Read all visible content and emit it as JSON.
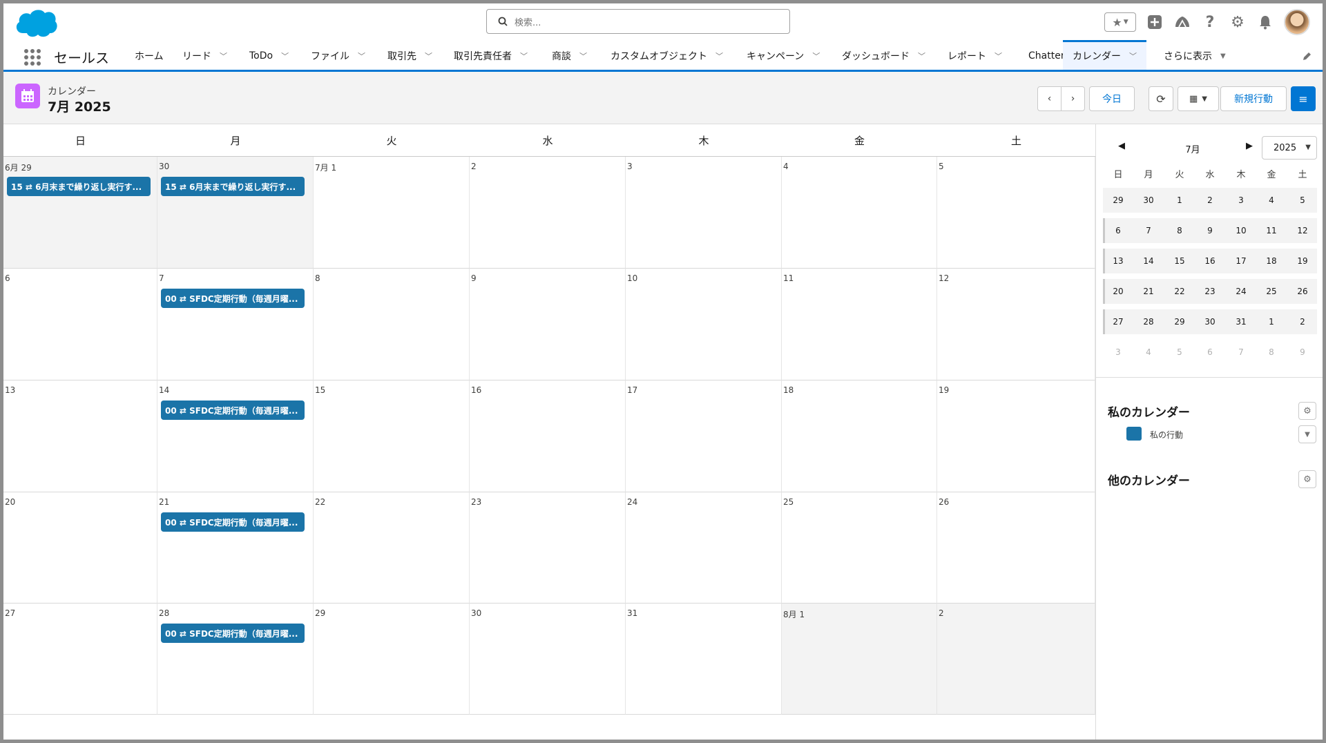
{
  "header": {
    "search_placeholder": "検索...",
    "favorites_icon": "star-icon",
    "icons": [
      "add-icon",
      "trailhead-icon",
      "help-icon",
      "setup-gear-icon",
      "notification-bell-icon"
    ]
  },
  "nav": {
    "app_name": "セールス",
    "items": [
      {
        "label": "ホーム",
        "has_menu": false
      },
      {
        "label": "リード",
        "has_menu": true
      },
      {
        "label": "ToDo",
        "has_menu": true
      },
      {
        "label": "ファイル",
        "has_menu": true
      },
      {
        "label": "取引先",
        "has_menu": true
      },
      {
        "label": "取引先責任者",
        "has_menu": true
      },
      {
        "label": "商談",
        "has_menu": true
      },
      {
        "label": "カスタムオブジェクト",
        "has_menu": true
      },
      {
        "label": "キャンペーン",
        "has_menu": true
      },
      {
        "label": "ダッシュボード",
        "has_menu": true
      },
      {
        "label": "レポート",
        "has_menu": true
      },
      {
        "label": "Chatter",
        "has_menu": false
      },
      {
        "label": "カレンダー",
        "has_menu": true,
        "active": true
      },
      {
        "label": "さらに表示",
        "has_menu": true
      }
    ]
  },
  "page": {
    "object_label": "カレンダー",
    "title": "7月 2025",
    "today_label": "今日",
    "new_event_label": "新規行動"
  },
  "calendar": {
    "weekdays": [
      "日",
      "月",
      "火",
      "水",
      "木",
      "金",
      "土"
    ],
    "weeks": [
      [
        {
          "d": "6月 29",
          "other": true,
          "event": "15 ⇄ 6月末まで繰り返し実行す..."
        },
        {
          "d": "30",
          "other": true,
          "event": "15 ⇄ 6月末まで繰り返し実行す..."
        },
        {
          "d": "7月 1"
        },
        {
          "d": "2"
        },
        {
          "d": "3"
        },
        {
          "d": "4"
        },
        {
          "d": "5"
        }
      ],
      [
        {
          "d": "6"
        },
        {
          "d": "7",
          "event": "00 ⇄ SFDC定期行動（毎週月曜..."
        },
        {
          "d": "8"
        },
        {
          "d": "9"
        },
        {
          "d": "10"
        },
        {
          "d": "11"
        },
        {
          "d": "12"
        }
      ],
      [
        {
          "d": "13"
        },
        {
          "d": "14",
          "event": "00 ⇄ SFDC定期行動（毎週月曜..."
        },
        {
          "d": "15"
        },
        {
          "d": "16"
        },
        {
          "d": "17"
        },
        {
          "d": "18"
        },
        {
          "d": "19"
        }
      ],
      [
        {
          "d": "20"
        },
        {
          "d": "21",
          "event": "00 ⇄ SFDC定期行動（毎週月曜..."
        },
        {
          "d": "22"
        },
        {
          "d": "23"
        },
        {
          "d": "24"
        },
        {
          "d": "25"
        },
        {
          "d": "26"
        }
      ],
      [
        {
          "d": "27"
        },
        {
          "d": "28",
          "event": "00 ⇄ SFDC定期行動（毎週月曜..."
        },
        {
          "d": "29"
        },
        {
          "d": "30"
        },
        {
          "d": "31"
        },
        {
          "d": "8月 1",
          "other": true
        },
        {
          "d": "2",
          "other": true
        }
      ]
    ]
  },
  "mini_calendar": {
    "month": "7月",
    "year": "2025",
    "weekdays": [
      "日",
      "月",
      "火",
      "水",
      "木",
      "金",
      "土"
    ],
    "rows": [
      [
        {
          "d": "29"
        },
        {
          "d": "30"
        },
        {
          "d": "1"
        },
        {
          "d": "2"
        },
        {
          "d": "3"
        },
        {
          "d": "4"
        },
        {
          "d": "5"
        }
      ],
      [
        {
          "d": "6"
        },
        {
          "d": "7"
        },
        {
          "d": "8"
        },
        {
          "d": "9"
        },
        {
          "d": "10"
        },
        {
          "d": "11"
        },
        {
          "d": "12"
        }
      ],
      [
        {
          "d": "13"
        },
        {
          "d": "14"
        },
        {
          "d": "15"
        },
        {
          "d": "16"
        },
        {
          "d": "17"
        },
        {
          "d": "18"
        },
        {
          "d": "19"
        }
      ],
      [
        {
          "d": "20"
        },
        {
          "d": "21"
        },
        {
          "d": "22"
        },
        {
          "d": "23"
        },
        {
          "d": "24"
        },
        {
          "d": "25"
        },
        {
          "d": "26"
        }
      ],
      [
        {
          "d": "27"
        },
        {
          "d": "28"
        },
        {
          "d": "29"
        },
        {
          "d": "30"
        },
        {
          "d": "31"
        },
        {
          "d": "1"
        },
        {
          "d": "2"
        }
      ],
      [
        {
          "d": "3",
          "dim": true
        },
        {
          "d": "4",
          "dim": true
        },
        {
          "d": "5",
          "dim": true
        },
        {
          "d": "6",
          "dim": true
        },
        {
          "d": "7",
          "dim": true
        },
        {
          "d": "8",
          "dim": true
        },
        {
          "d": "9",
          "dim": true
        }
      ]
    ]
  },
  "sidebar": {
    "my_calendars_title": "私のカレンダー",
    "my_calendar_item": "私の行動",
    "my_calendar_color": "#1b74a8",
    "other_calendars_title": "他のカレンダー"
  },
  "colors": {
    "brand": "#0176d3",
    "event": "#1b74a8",
    "calendar_icon": "#cb65ff"
  }
}
